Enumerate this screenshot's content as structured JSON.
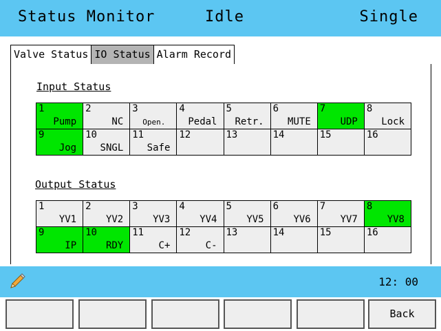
{
  "header": {
    "title": "Status Monitor",
    "mode": "Idle",
    "run_mode": "Single"
  },
  "tabs": [
    {
      "label": "Valve Status",
      "active": false
    },
    {
      "label": "IO Status",
      "active": true
    },
    {
      "label": "Alarm Record",
      "active": false
    }
  ],
  "input_status": {
    "label": "Input Status",
    "cells": [
      {
        "num": "1",
        "label": "Pump",
        "on": true
      },
      {
        "num": "2",
        "label": "NC",
        "on": false
      },
      {
        "num": "3",
        "label": "Open.",
        "on": false
      },
      {
        "num": "4",
        "label": "Pedal",
        "on": false
      },
      {
        "num": "5",
        "label": "Retr.",
        "on": false
      },
      {
        "num": "6",
        "label": "MUTE",
        "on": false
      },
      {
        "num": "7",
        "label": "UDP",
        "on": true
      },
      {
        "num": "8",
        "label": "Lock",
        "on": false
      },
      {
        "num": "9",
        "label": "Jog",
        "on": true
      },
      {
        "num": "10",
        "label": "SNGL",
        "on": false
      },
      {
        "num": "11",
        "label": "Safe",
        "on": false
      },
      {
        "num": "12",
        "label": "",
        "on": false
      },
      {
        "num": "13",
        "label": "",
        "on": false
      },
      {
        "num": "14",
        "label": "",
        "on": false
      },
      {
        "num": "15",
        "label": "",
        "on": false
      },
      {
        "num": "16",
        "label": "",
        "on": false
      }
    ]
  },
  "output_status": {
    "label": "Output Status",
    "cells": [
      {
        "num": "1",
        "label": "YV1",
        "on": false
      },
      {
        "num": "2",
        "label": "YV2",
        "on": false
      },
      {
        "num": "3",
        "label": "YV3",
        "on": false
      },
      {
        "num": "4",
        "label": "YV4",
        "on": false
      },
      {
        "num": "5",
        "label": "YV5",
        "on": false
      },
      {
        "num": "6",
        "label": "YV6",
        "on": false
      },
      {
        "num": "7",
        "label": "YV7",
        "on": false
      },
      {
        "num": "8",
        "label": "YV8",
        "on": true
      },
      {
        "num": "9",
        "label": "IP",
        "on": true
      },
      {
        "num": "10",
        "label": "RDY",
        "on": true
      },
      {
        "num": "11",
        "label": "C+",
        "on": false
      },
      {
        "num": "12",
        "label": "C-",
        "on": false
      },
      {
        "num": "13",
        "label": "",
        "on": false
      },
      {
        "num": "14",
        "label": "",
        "on": false
      },
      {
        "num": "15",
        "label": "",
        "on": false
      },
      {
        "num": "16",
        "label": "",
        "on": false
      }
    ]
  },
  "status_bar": {
    "icon": "pencil-icon",
    "time": "12: 00"
  },
  "footer": {
    "buttons": [
      {
        "label": ""
      },
      {
        "label": ""
      },
      {
        "label": ""
      },
      {
        "label": ""
      },
      {
        "label": ""
      },
      {
        "label": "Back"
      }
    ]
  },
  "colors": {
    "accent": "#5cc6f2",
    "on": "#00e600",
    "off": "#eeeeee",
    "tab_active": "#b4b4b4"
  }
}
